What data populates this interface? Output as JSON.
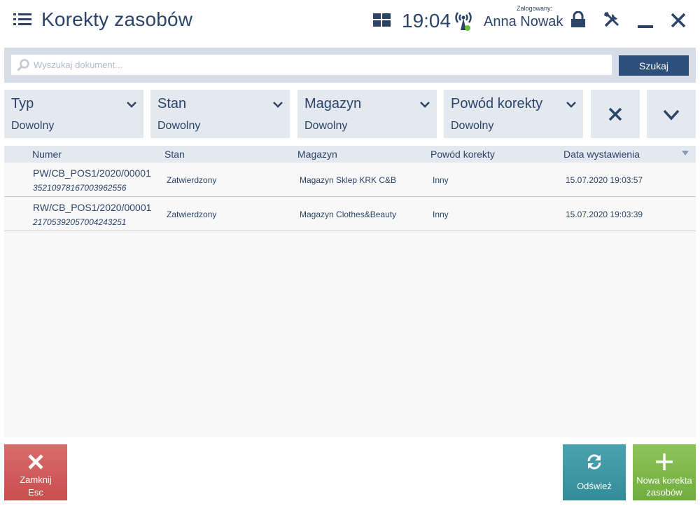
{
  "header": {
    "title": "Korekty zasobów",
    "time": "19:04",
    "logged_label": "Zalogowany:",
    "user_name": "Anna Nowak"
  },
  "search": {
    "placeholder": "Wyszukaj dokument...",
    "value": "",
    "button_label": "Szukaj"
  },
  "filters": [
    {
      "label": "Typ",
      "value": "Dowolny"
    },
    {
      "label": "Stan",
      "value": "Dowolny"
    },
    {
      "label": "Magazyn",
      "value": "Dowolny"
    },
    {
      "label": "Powód korekty",
      "value": "Dowolny"
    }
  ],
  "table": {
    "columns": [
      "Numer",
      "Stan",
      "Magazyn",
      "Powód korekty",
      "Data wystawienia"
    ],
    "rows": [
      {
        "number": "PW/CB_POS1/2020/00001",
        "code": "35210978167003962556",
        "status": "Zatwierdzony",
        "warehouse": "Magazyn Sklep KRK C&B",
        "reason": "Inny",
        "date": "15.07.2020 19:03:57"
      },
      {
        "number": "RW/CB_POS1/2020/00001",
        "code": "21705392057004243251",
        "status": "Zatwierdzony",
        "warehouse": "Magazyn Clothes&Beauty",
        "reason": "Inny",
        "date": "15.07.2020 19:03:39"
      }
    ]
  },
  "actions": {
    "close": {
      "line1": "Zamknij",
      "line2": "Esc"
    },
    "refresh": {
      "line1": "Odśwież"
    },
    "new": {
      "line1": "Nowa korekta",
      "line2": "zasobów"
    }
  },
  "colors": {
    "text": "#2b4468",
    "close": "#d05a5a",
    "refresh": "#3d98a4",
    "new": "#80b94c",
    "signal_dot": "#6cbf3c"
  },
  "icons": [
    "menu-icon",
    "grid-icon",
    "signal-icon",
    "lock-icon",
    "tools-icon",
    "minimize-icon",
    "close-icon",
    "search-icon",
    "chevron-down-icon",
    "clear-filter-icon",
    "expand-icon",
    "sort-icon",
    "refresh-icon",
    "plus-icon"
  ]
}
